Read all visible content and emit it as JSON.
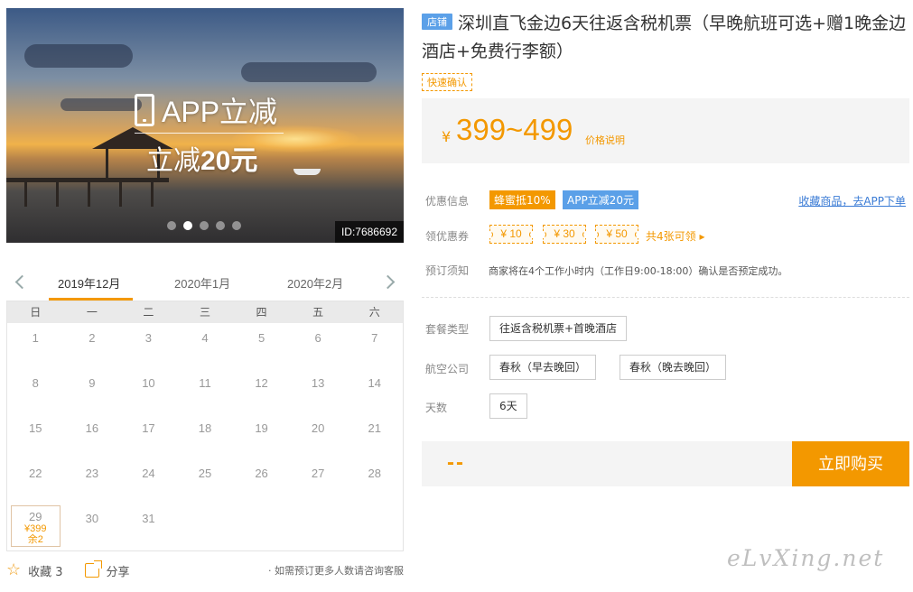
{
  "banner": {
    "promo_title": "APP立减",
    "promo_prefix": "立减",
    "promo_amount": "20元",
    "id_tag": "ID:7686692",
    "slides": 5,
    "active_slide": 2
  },
  "calendar": {
    "months": [
      "2019年12月",
      "2020年1月",
      "2020年2月"
    ],
    "active_month": "2019年12月",
    "weekdays": [
      "日",
      "一",
      "二",
      "三",
      "四",
      "五",
      "六"
    ],
    "days": [
      "1",
      "2",
      "3",
      "4",
      "5",
      "6",
      "7",
      "8",
      "9",
      "10",
      "11",
      "12",
      "13",
      "14",
      "15",
      "16",
      "17",
      "18",
      "19",
      "20",
      "21",
      "22",
      "23",
      "24",
      "25",
      "26",
      "27",
      "28",
      "29",
      "30",
      "31"
    ],
    "selected_day": "29",
    "selected_price": "¥399",
    "selected_stock": "余2"
  },
  "footer": {
    "favorite_label": "收藏 3",
    "share_label": "分享",
    "note": "· 如需预订更多人数请咨询客服"
  },
  "product": {
    "shop_badge": "店铺",
    "title": "深圳直飞金边6天往返含税机票（早晚航班可选+赠1晚金边酒店+免费行李额）",
    "quick_tag": "快速确认",
    "currency": "¥",
    "price_range": "399~499",
    "price_note": "价格说明"
  },
  "offers": {
    "label": "优惠信息",
    "tag1": "蜂蜜抵10%",
    "tag2": "APP立减20元",
    "save_link": "收藏商品，去APP下单"
  },
  "coupons": {
    "label": "领优惠券",
    "items": [
      "¥ 10",
      "¥ 30",
      "¥ 50"
    ],
    "more": "共4张可领 ▸"
  },
  "notice": {
    "label": "预订须知",
    "text": "商家将在4个工作小时内（工作日9:00-18:00）确认是否预定成功。"
  },
  "options": {
    "package_label": "套餐类型",
    "package_values": [
      "往返含税机票+首晚酒店"
    ],
    "airline_label": "航空公司",
    "airline_values": [
      "春秋（早去晚回）",
      "春秋（晚去晚回）"
    ],
    "days_label": "天数",
    "days_values": [
      "6天"
    ]
  },
  "buy": {
    "dash": "--",
    "button": "立即购买"
  },
  "watermark": "eLvXing.net",
  "colors": {
    "accent": "#f39800",
    "link": "#3a7bd5",
    "badge_blue": "#5ba0e8"
  }
}
